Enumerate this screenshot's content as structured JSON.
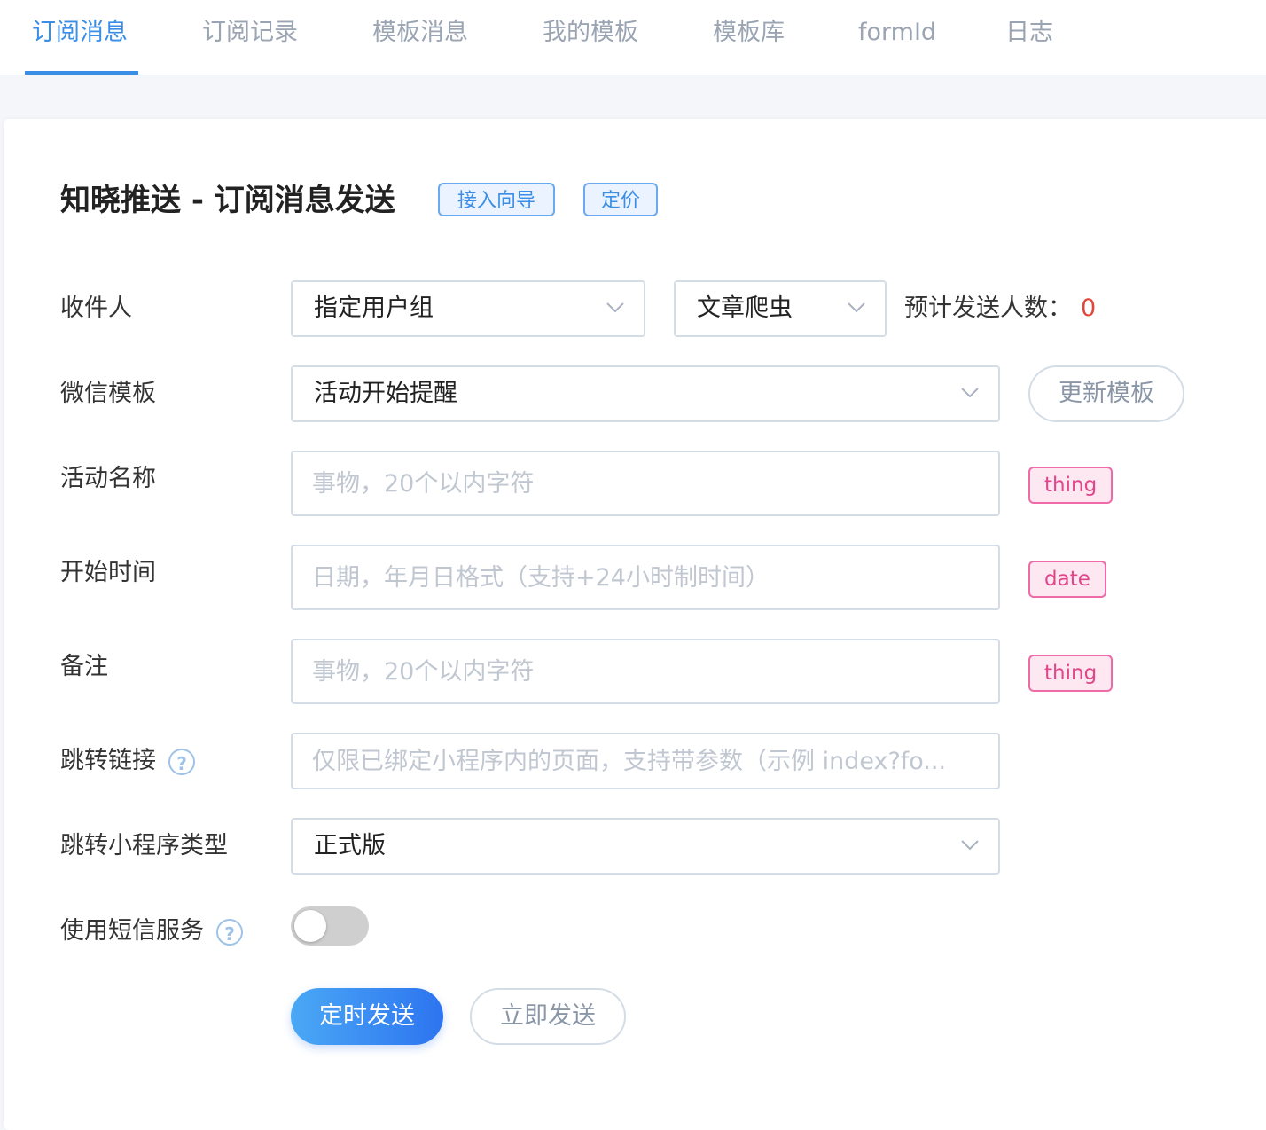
{
  "tabs": [
    {
      "label": "订阅消息",
      "active": true
    },
    {
      "label": "订阅记录",
      "active": false
    },
    {
      "label": "模板消息",
      "active": false
    },
    {
      "label": "我的模板",
      "active": false
    },
    {
      "label": "模板库",
      "active": false
    },
    {
      "label": "formId",
      "active": false
    },
    {
      "label": "日志",
      "active": false
    }
  ],
  "header": {
    "title": "知晓推送 - 订阅消息发送",
    "guide_button": "接入向导",
    "pricing_button": "定价"
  },
  "form": {
    "recipient": {
      "label": "收件人",
      "group_select": "指定用户组",
      "group_name_select": "文章爬虫",
      "estimate_label": "预计发送人数：",
      "estimate_value": "0"
    },
    "template": {
      "label": "微信模板",
      "selected": "活动开始提醒",
      "refresh_button": "更新模板"
    },
    "activity_name": {
      "label": "活动名称",
      "placeholder": "事物，20个以内字符",
      "value": "",
      "tag": "thing"
    },
    "start_time": {
      "label": "开始时间",
      "placeholder": "日期，年月日格式（支持+24小时制时间）",
      "value": "",
      "tag": "date"
    },
    "remark": {
      "label": "备注",
      "placeholder": "事物，20个以内字符",
      "value": "",
      "tag": "thing"
    },
    "jump_link": {
      "label": "跳转链接",
      "placeholder": "仅限已绑定小程序内的页面，支持带参数（示例 index?fo...",
      "value": ""
    },
    "miniprogram_type": {
      "label": "跳转小程序类型",
      "selected": "正式版"
    },
    "sms": {
      "label": "使用短信服务",
      "enabled": false
    }
  },
  "actions": {
    "scheduled_send": "定时发送",
    "send_now": "立即发送"
  },
  "icons": {
    "help": "question-circle-icon",
    "chevron": "chevron-down-icon"
  },
  "colors": {
    "accent": "#3a8ee6",
    "tag_pink": "#e0468a",
    "count_red": "#e0473a"
  }
}
